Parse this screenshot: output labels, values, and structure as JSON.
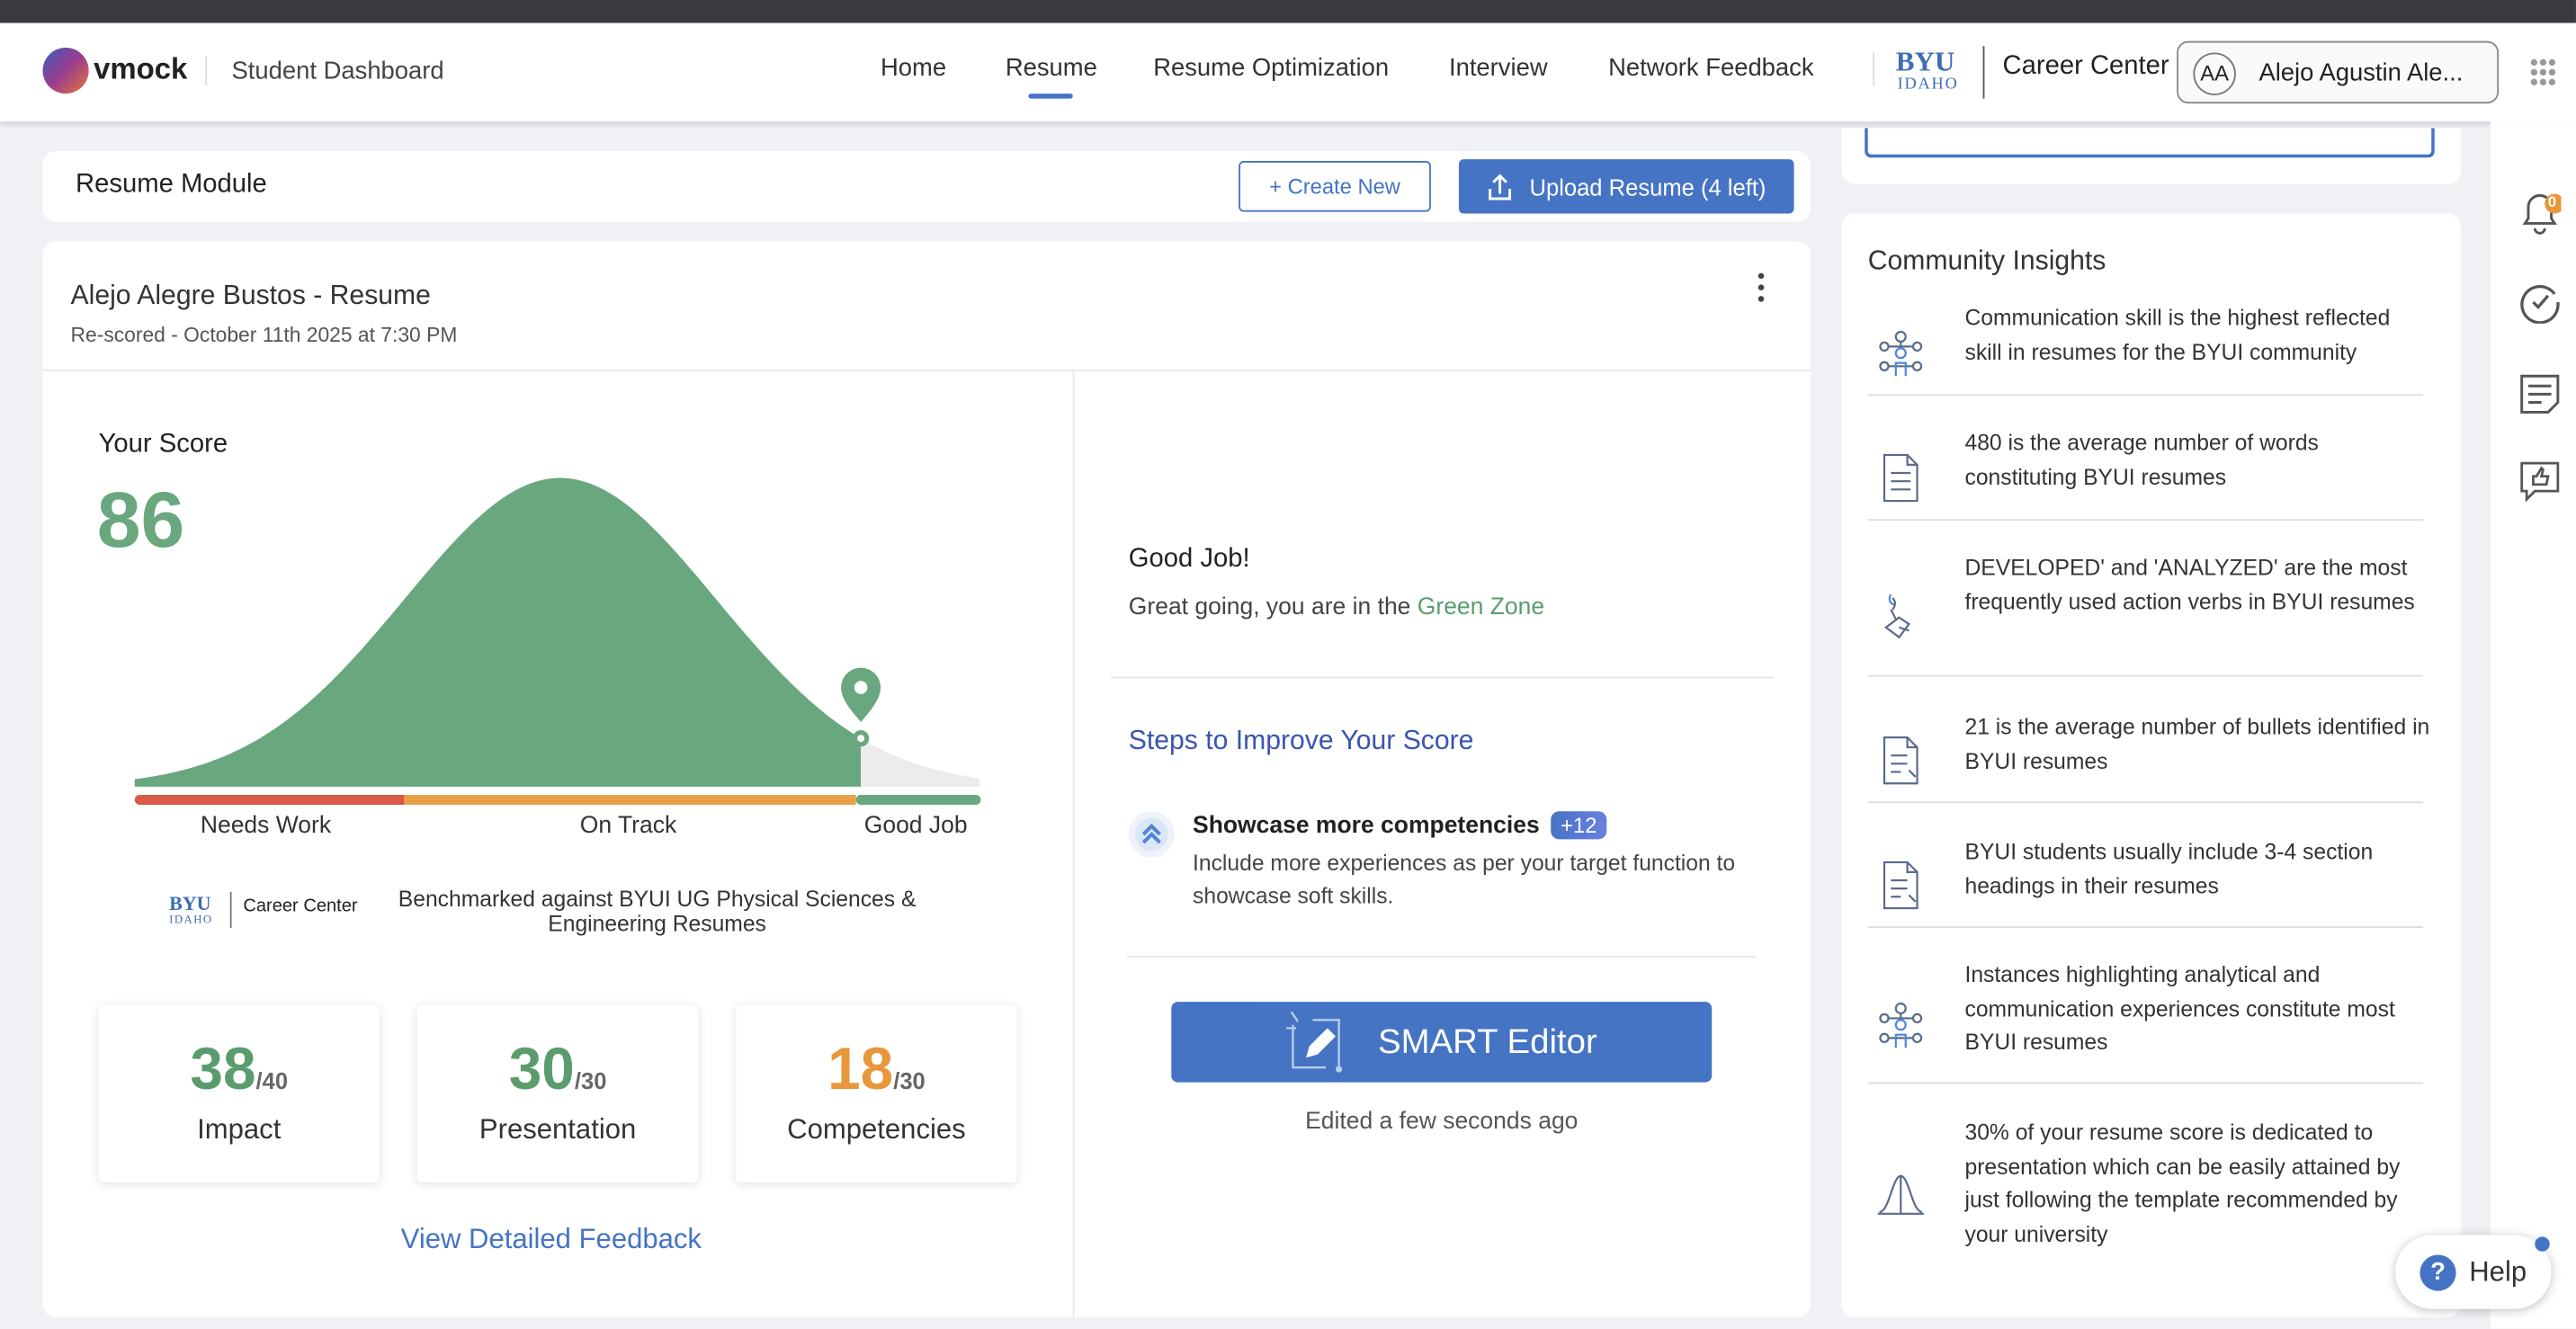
{
  "header": {
    "logo": "vmock",
    "app_title": "Student Dashboard",
    "nav": [
      "Home",
      "Resume",
      "Resume Optimization",
      "Interview",
      "Network Feedback"
    ],
    "active_nav": "Resume",
    "school_logo": {
      "top": "BYU",
      "bottom": "IDAHO"
    },
    "career_center": "Career Center",
    "user_initials": "AA",
    "user_name": "Alejo Agustin Ale..."
  },
  "module": {
    "title": "Resume Module",
    "create_label": "+ Create New",
    "upload_label": "Upload Resume (4 left)"
  },
  "resume": {
    "title": "Alejo Alegre Bustos - Resume",
    "rescored": "Re-scored - October 11th 2025 at 7:30 PM",
    "score_label": "Your Score",
    "score": "86",
    "score_value": 86,
    "zones": [
      "Needs Work",
      "On Track",
      "Good Job"
    ],
    "zone_colors": [
      "#d95a47",
      "#e6a045",
      "#69a77e"
    ],
    "benchmark_logo": {
      "top": "BYU",
      "bottom": "IDAHO",
      "text": "Career Center"
    },
    "benchmark": "Benchmarked against BYUI UG Physical Sciences & Engineering Resumes",
    "subscores": [
      {
        "value": "38",
        "max": "/40",
        "label": "Impact",
        "color": "#5a9c6e"
      },
      {
        "value": "30",
        "max": "/30",
        "label": "Presentation",
        "color": "#5a9c6e"
      },
      {
        "value": "18",
        "max": "/30",
        "label": "Competencies",
        "color": "#e8973a"
      }
    ],
    "detail_link": "View Detailed Feedback"
  },
  "feedback": {
    "heading": "Good Job!",
    "text": "Great going, you are in the ",
    "zone": "Green Zone",
    "steps_title": "Steps to Improve Your Score",
    "step": {
      "title": "Showcase more competencies",
      "badge": "+12",
      "desc": "Include more experiences as per your target function to showcase soft skills."
    },
    "smart_editor": "SMART Editor",
    "edited": "Edited a few seconds ago"
  },
  "insights": {
    "title": "Community Insights",
    "items": [
      {
        "icon": "network-people-icon",
        "text": "Communication skill is the highest reflected skill in resumes for the BYUI community"
      },
      {
        "icon": "document-icon",
        "text": "480 is the average number of words constituting BYUI resumes"
      },
      {
        "icon": "hand-torch-icon",
        "text": "DEVELOPED' and 'ANALYZED' are the most frequently used action verbs in BYUI resumes"
      },
      {
        "icon": "document-list-icon",
        "text": "21 is the average number of bullets identified in BYUI resumes"
      },
      {
        "icon": "document-list-icon",
        "text": "BYUI students usually include 3-4 section headings in their resumes"
      },
      {
        "icon": "network-people-icon",
        "text": "Instances highlighting analytical and communication experiences constitute most BYUI resumes"
      },
      {
        "icon": "bell-curve-icon",
        "text": "30% of your resume score is dedicated to presentation which can be easily attained by just following the template recommended by your university"
      }
    ]
  },
  "sidebar": {
    "notifications": "0"
  },
  "help": "Help"
}
